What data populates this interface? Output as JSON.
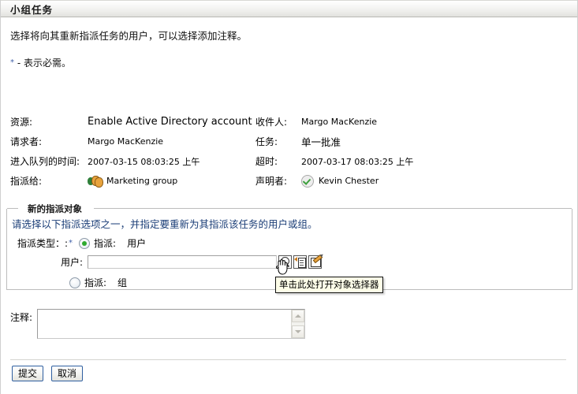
{
  "window": {
    "title": "小组任务"
  },
  "intro": {
    "description": "选择将向其重新指派任务的用户，可以选择添加注释。",
    "required_star": "*",
    "required_note": "- 表示必需。"
  },
  "details": {
    "rows": [
      {
        "left_label": "资源:",
        "left_value": "Enable Active Directory account",
        "left_big": true,
        "right_label": "收件人:",
        "right_value": "Margo MacKenzie",
        "right_icon": null
      },
      {
        "left_label": "请求者:",
        "left_value": "Margo MacKenzie",
        "left_big": false,
        "right_label": "任务:",
        "right_value": "单一批准",
        "right_icon": null
      },
      {
        "left_label": "进入队列的时间:",
        "left_value": "2007-03-15 08:03:25 上午",
        "left_big": false,
        "right_label": "超时:",
        "right_value": "2007-03-17 08:03:25 上午",
        "right_icon": null
      },
      {
        "left_label": "指派给:",
        "left_value": "Marketing group",
        "left_big": false,
        "left_icon": "group-icon",
        "right_label": "声明者:",
        "right_value": "Kevin Chester",
        "right_icon": "check-circle-icon"
      }
    ]
  },
  "fieldset": {
    "legend": "新的指派对象",
    "instruction": "请选择以下指派选项之一，并指定要重新为其指派该任务的用户或组。",
    "assign_type_label": "指派类型：:",
    "assign_type_star": "*",
    "option_user": {
      "prefix": "指派:",
      "value": "用户",
      "selected": true
    },
    "option_group": {
      "prefix": "指派:",
      "value": "组",
      "selected": false
    },
    "user_field": {
      "label": "用户:",
      "value": "",
      "placeholder": ""
    },
    "icons": [
      {
        "name": "object-selector-icon",
        "title": "单击此处打开对象选择器"
      },
      {
        "name": "history-clipboard-icon",
        "title": ""
      },
      {
        "name": "edit-note-icon",
        "title": ""
      }
    ],
    "tooltip": "单击此处打开对象选择器"
  },
  "comment": {
    "label": "注释:",
    "value": "",
    "placeholder": ""
  },
  "footer": {
    "submit_label": "提交",
    "cancel_label": "取消"
  },
  "colors": {
    "accent_blue": "#1c3f78",
    "required_star": "#3f5fa8",
    "button_border": "#2f5fa0",
    "radio_fill": "#2faa2f",
    "tooltip_bg": "#fdfde8"
  }
}
